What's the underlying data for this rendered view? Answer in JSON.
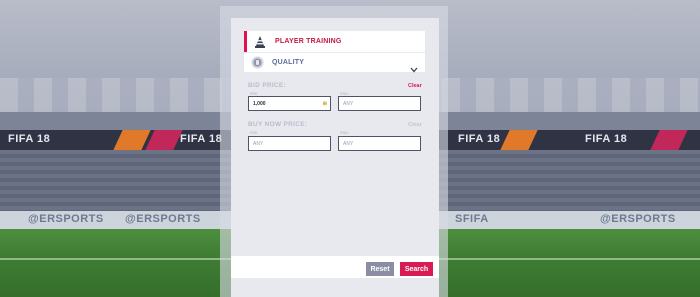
{
  "background": {
    "ad_texts": [
      "FIFA 18",
      "FIFA 18",
      "FIFA 18",
      "FIFA 18"
    ],
    "board_texts": [
      "@ERSPORTS",
      "@ERSPORTS",
      "SFIFA",
      "@ERSPORTS"
    ]
  },
  "filter": {
    "category": {
      "label": "PLAYER TRAINING",
      "icon": "cone-icon",
      "accent": "#e0124e"
    },
    "quality": {
      "label": "QUALITY",
      "icon": "quality-badge-icon"
    }
  },
  "bid_price": {
    "title": "BID PRICE:",
    "clear_label": "Clear",
    "clear_color": "#d81a55",
    "min_label": "Min:",
    "min_value": "1,000",
    "max_label": "Max:",
    "max_placeholder": "ANY"
  },
  "buy_now_price": {
    "title": "BUY NOW PRICE:",
    "clear_label": "Clear",
    "clear_color": "#c3c5d1",
    "min_label": "Min:",
    "min_placeholder": "ANY",
    "max_label": "Max:",
    "max_placeholder": "ANY"
  },
  "actions": {
    "reset_label": "Reset",
    "search_label": "Search"
  }
}
